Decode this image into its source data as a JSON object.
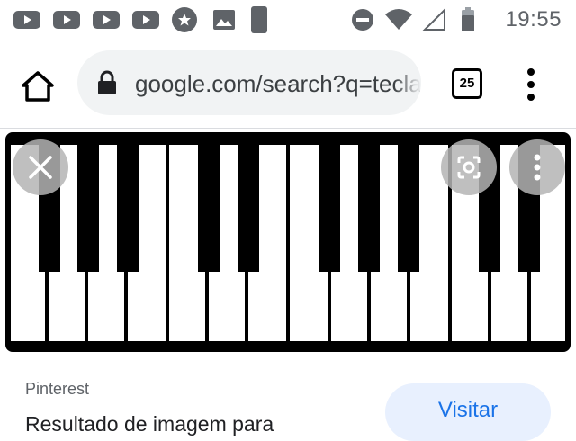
{
  "status_bar": {
    "time": "19:55",
    "notification_icons": [
      "youtube-icon",
      "youtube-icon",
      "youtube-icon",
      "youtube-icon",
      "star-icon",
      "image-icon",
      "moon-icon"
    ],
    "system_icons": [
      "do-not-disturb-icon",
      "wifi-icon",
      "signal-icon",
      "battery-icon"
    ]
  },
  "toolbar": {
    "url": "google.com/search?q=teclado",
    "tab_count": "25"
  },
  "image_viewer": {
    "content": "piano-keyboard"
  },
  "result": {
    "source": "Pinterest",
    "title": "Resultado de imagem para",
    "visit_label": "Visitar"
  },
  "colors": {
    "accent": "#1a73e8",
    "visit_bg": "#e8f0fe",
    "url_bar_bg": "#f1f3f4",
    "status_icons": "#5f6368"
  }
}
